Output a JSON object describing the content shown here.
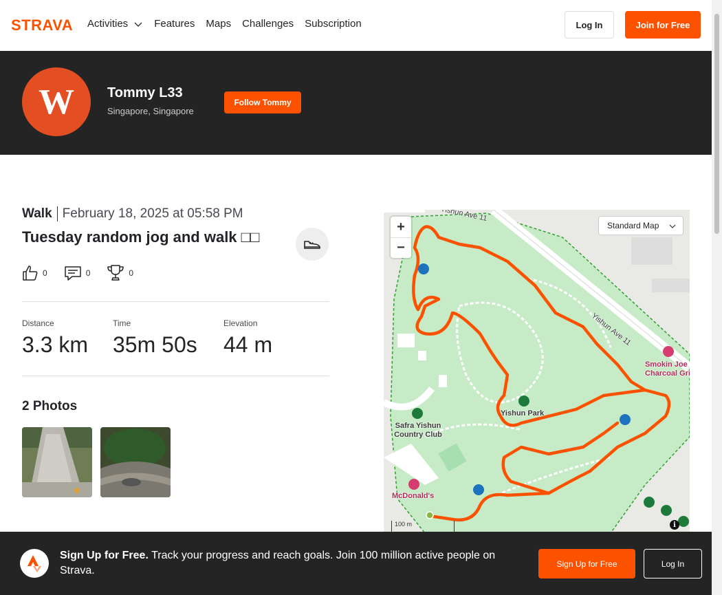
{
  "brand": {
    "logo_text": "STRAVA",
    "accent": "#fc5200"
  },
  "nav": {
    "links": [
      "Activities",
      "Features",
      "Maps",
      "Challenges",
      "Subscription"
    ],
    "login": "Log In",
    "join": "Join for Free"
  },
  "athlete": {
    "initial": "W",
    "name": "Tommy L33",
    "location": "Singapore, Singapore",
    "follow": "Follow Tommy"
  },
  "activity": {
    "type": "Walk",
    "date": "February 18, 2025 at 05:58 PM",
    "title": "Tuesday random jog and walk □□",
    "kudos": "0",
    "comments": "0",
    "achievements": "0",
    "stats": [
      {
        "label": "Distance",
        "value": "3.3 km"
      },
      {
        "label": "Time",
        "value": "35m 50s"
      },
      {
        "label": "Elevation",
        "value": "44 m"
      }
    ],
    "photos_title": "2 Photos"
  },
  "map": {
    "style": "Standard Map",
    "zoom_in": "+",
    "zoom_out": "−",
    "labels": {
      "road1": "Yishun Ave 11",
      "road2": "Yishun Ave 11",
      "park": "Yishun Park",
      "club": "Safra Yishun Country Club",
      "food1": "McDonald's",
      "food2": "Smokin Joe Charcoal Gri"
    },
    "scale": "100 m",
    "info": "i"
  },
  "cta": {
    "headline": "Sign Up for Free.",
    "body": "Track your progress and reach goals. Join 100 million active people on Strava.",
    "join": "Sign Up for Free",
    "login": "Log In"
  }
}
